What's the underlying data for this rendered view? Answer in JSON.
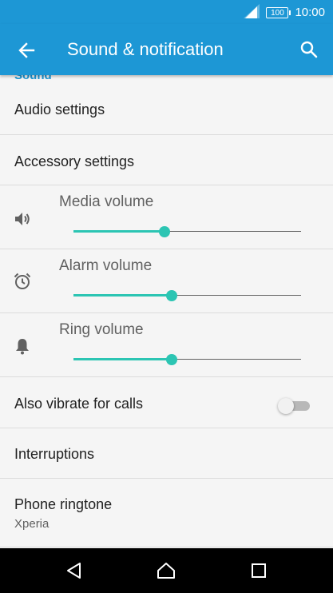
{
  "status_bar": {
    "signal_icon": "signal-icon",
    "battery_text": "100",
    "time": "10:00"
  },
  "app_bar": {
    "back_icon": "arrow-left-icon",
    "title": "Sound & notification",
    "search_icon": "search-icon"
  },
  "section": {
    "header": "Sound"
  },
  "items": {
    "audio_settings": "Audio settings",
    "accessory_settings": "Accessory settings",
    "vibrate_for_calls": {
      "label": "Also vibrate for calls",
      "enabled": false
    },
    "interruptions": "Interruptions",
    "phone_ringtone": {
      "label": "Phone ringtone",
      "value": "Xperia"
    }
  },
  "volumes": [
    {
      "label": "Media volume",
      "icon": "speaker-icon",
      "level": 0.4
    },
    {
      "label": "Alarm volume",
      "icon": "alarm-clock-icon",
      "level": 0.43
    },
    {
      "label": "Ring volume",
      "icon": "bell-icon",
      "level": 0.43
    }
  ],
  "nav_bar": {
    "back": "back-triangle-icon",
    "home": "home-icon",
    "recents": "recents-square-icon"
  },
  "colors": {
    "primary": "#1d97d5",
    "accent": "#2cc5b3",
    "background": "#f5f5f5",
    "text": "#212121",
    "secondary_text": "#616161"
  }
}
